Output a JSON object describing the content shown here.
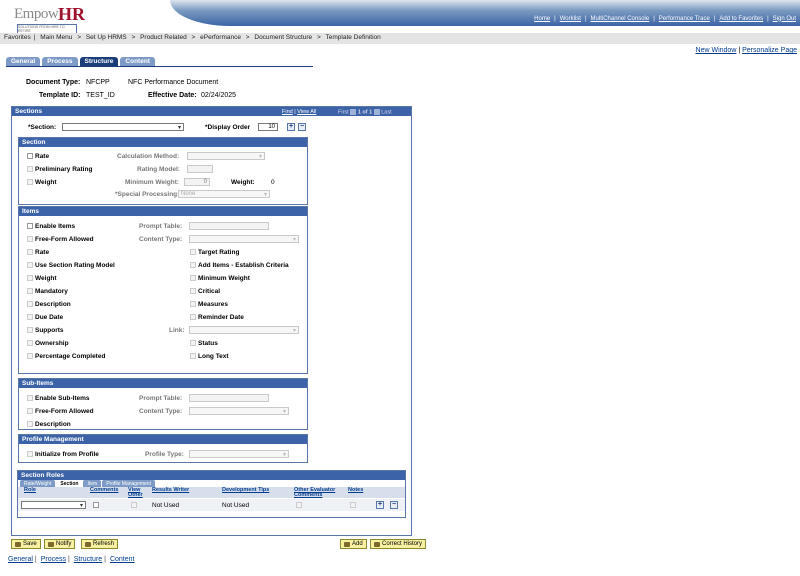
{
  "brand": {
    "logo_part1": "Empow",
    "logo_part2": "HR",
    "logo_tagline": "SOLUTIONS FROM HIRE TO RETIRE"
  },
  "top_links": [
    "Home",
    "Worklist",
    "MultiChannel Console",
    "Performance Trace",
    "Add to Favorites",
    "Sign Out"
  ],
  "breadcrumb": [
    "Favorites",
    "Main Menu",
    ">",
    "Set Up HRMS",
    ">",
    "Product Related",
    ">",
    "ePerformance",
    ">",
    "Document Structure",
    ">",
    "Template Definition"
  ],
  "page_links": {
    "new_window": "New Window",
    "sep": "|",
    "personalize": "Personalize Page"
  },
  "tabs": [
    {
      "label": "General",
      "active": false
    },
    {
      "label": "Process",
      "active": false
    },
    {
      "label": "Structure",
      "active": true
    },
    {
      "label": "Content",
      "active": false
    }
  ],
  "header": {
    "doc_type_label": "Document Type:",
    "doc_type_value": "NFCPP",
    "doc_type_desc": "NFC Performance Document",
    "template_label": "Template ID:",
    "template_value": "TEST_ID",
    "eff_date_label": "Effective Date:",
    "eff_date_value": "02/24/2025"
  },
  "sections_box": {
    "title": "Sections",
    "find": "Find",
    "view_all": "View All",
    "first": "First",
    "pager": "1 of 1",
    "last": "Last",
    "section_label": "*Section:",
    "display_order_label": "*Display Order",
    "display_order_value": "10",
    "plus": "+",
    "minus": "−"
  },
  "section_panel": {
    "title": "Section",
    "rate": "Rate",
    "calc_method": "Calculation Method:",
    "preliminary_rating": "Preliminary Rating",
    "rating_model": "Rating Model:",
    "weight": "Weight",
    "min_weight": "Minimum Weight:",
    "min_weight_value": "0",
    "weight_label": "Weight:",
    "weight_value": "0",
    "special_processing": "*Special Processing:",
    "special_processing_value": "None"
  },
  "items_panel": {
    "title": "Items",
    "enable_items": "Enable Items",
    "prompt_table": "Prompt Table:",
    "free_form": "Free-Form Allowed",
    "content_type": "Content Type:",
    "left": [
      "Rate",
      "Use Section Rating Model",
      "Weight",
      "Mandatory",
      "Description",
      "Due Date",
      "Supports",
      "Ownership",
      "Percentage Completed"
    ],
    "right": [
      "Target Rating",
      "Add Items - Establish Criteria",
      "Minimum Weight",
      "Critical",
      "Measures",
      "Reminder Date"
    ],
    "link_label": "Link:",
    "status": "Status",
    "long_text": "Long Text"
  },
  "subitems_panel": {
    "title": "Sub-Items",
    "enable": "Enable Sub-Items",
    "prompt_table": "Prompt Table:",
    "free_form": "Free-Form Allowed",
    "content_type": "Content Type:",
    "description": "Description"
  },
  "profile_panel": {
    "title": "Profile Management",
    "init": "Initialize from Profile",
    "profile_type": "Profile Type:"
  },
  "roles": {
    "title": "Section Roles",
    "tabs": [
      "Rate/Weight",
      "Section",
      "Item",
      "Profile Management"
    ],
    "headers": [
      "Role",
      "Comments",
      "View Other",
      "Results Writer",
      "Development Tips",
      "Other Evaluator Comments",
      "Notes"
    ],
    "row": {
      "results_writer": "Not Used",
      "development_tips": "Not Used"
    }
  },
  "buttons": {
    "save": "Save",
    "notify": "Notify",
    "refresh": "Refresh",
    "add": "Add",
    "correct_history": "Correct History"
  },
  "footer_links": [
    "General",
    "Process",
    "Structure",
    "Content"
  ]
}
